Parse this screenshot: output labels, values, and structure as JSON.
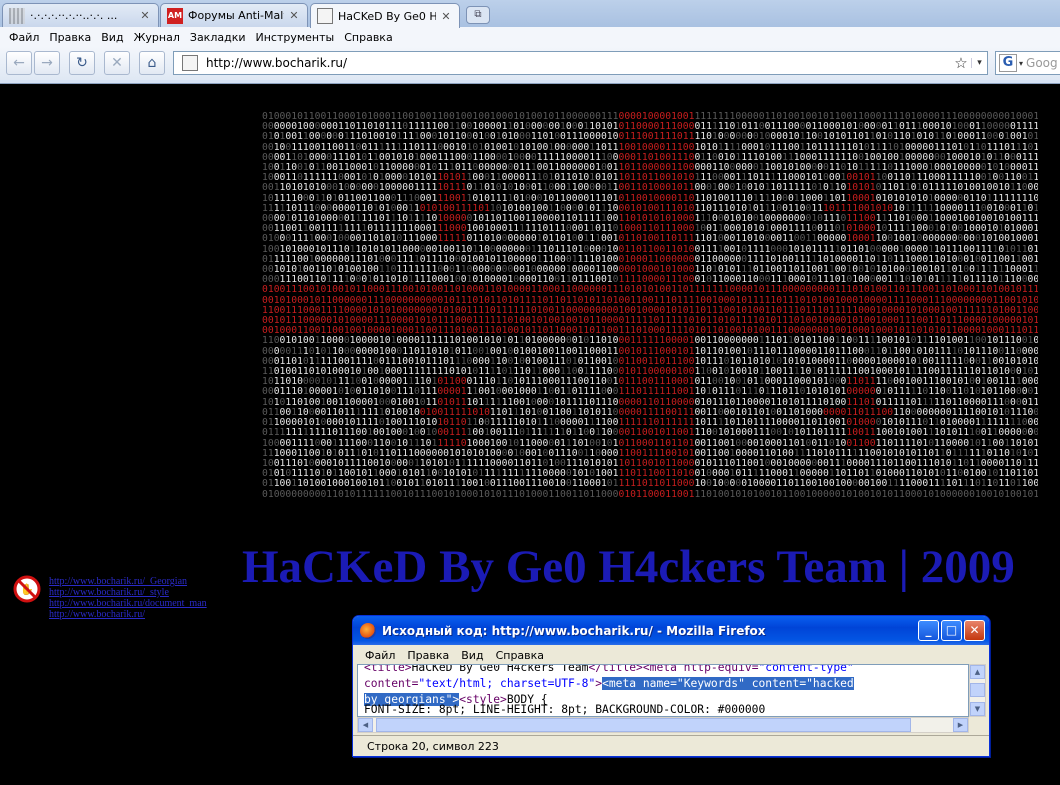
{
  "browser": {
    "tabs": [
      {
        "label": "·.·.·.·.··.·.··..·.·. ...",
        "active": false,
        "favicon": "blurred-favicon"
      },
      {
        "label": "Форумы Anti-Malw...",
        "active": false,
        "favicon": "am-favicon"
      },
      {
        "label": "HaCKeD By Ge0 H4...",
        "active": true,
        "favicon": "page-favicon"
      }
    ],
    "tab_close": "✕",
    "new_tab": "⧉",
    "menu": [
      "Файл",
      "Правка",
      "Вид",
      "Журнал",
      "Закладки",
      "Инструменты",
      "Справка"
    ],
    "nav": {
      "back": "←",
      "forward": "→",
      "reload": "↻",
      "stop": "✕",
      "home": "⌂"
    },
    "url": "http://www.bocharik.ru/",
    "bookmark_star": "☆",
    "url_dropdown": "▾",
    "search": {
      "engine": "G",
      "dropdown": "▾",
      "placeholder": "Goog"
    }
  },
  "page": {
    "hacked_title": "HaCKeD By Ge0 H4ckers Team | 2009",
    "links": [
      "http://www.bocharik.ru/_Georgian",
      "http://www.bocharik.ru/_style",
      "http://www.bocharik.ru/document_man",
      "http://www.bocharik.ru/"
    ]
  },
  "view_source_window": {
    "title": "Исходный код: http://www.bocharik.ru/ - Mozilla Firefox",
    "menu": [
      "Файл",
      "Правка",
      "Вид",
      "Справка"
    ],
    "buttons": {
      "minimize": "_",
      "maximize": "□",
      "close": "✕"
    },
    "code": {
      "l1_open_title": "<title>",
      "l1_title_text": "HaCKeD By Ge0 H4ckers Team",
      "l1_close_title": "</title>",
      "l1_meta_open": "<meta http-equiv=",
      "l1_meta_value": "\"content-type\"",
      "l2_attr": "content=",
      "l2_value": "\"text/html; charset=UTF-8\"",
      "l2_close": ">",
      "l2_selected": "<meta name=\"Keywords\" content=\"hacked",
      "l3_selected": "by georgians\">",
      "l3_style": "<style>",
      "l3_body": "BODY {",
      "l4_partial": "FONT-SIZE: 8pt; LINE-HEIGHT: 8pt; BACKGROUND-COLOR: #000000"
    },
    "status": "Строка 20, символ 223",
    "scroll_arrows": {
      "up": "▲",
      "down": "▼",
      "left": "◀",
      "right": "▶"
    }
  },
  "colors": {
    "page_background": "#000000",
    "title_blue": "#1b1bb5",
    "binary_red": "#c81e1e",
    "selection": "#316ac5"
  }
}
